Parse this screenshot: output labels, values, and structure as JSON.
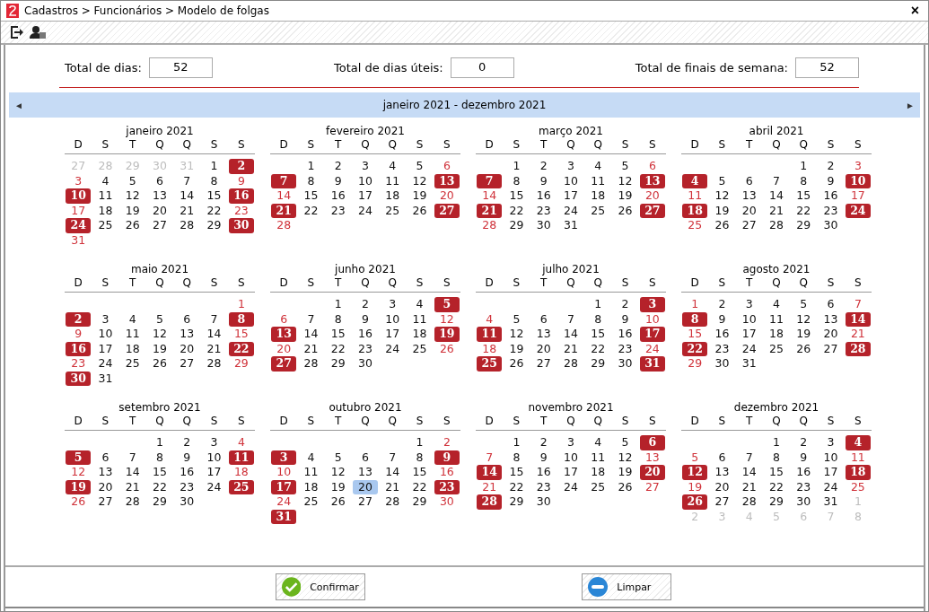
{
  "window": {
    "title": "Cadastros > Funcionários > Modelo de folgas",
    "close": "×"
  },
  "totals": [
    {
      "label": "Total de dias:",
      "value": "52"
    },
    {
      "label": "Total de dias úteis:",
      "value": "0"
    },
    {
      "label": "Total de finais de semana:",
      "value": "52"
    }
  ],
  "navigator": {
    "prev": "◄",
    "range": "janeiro 2021 - dezembro 2021",
    "next": "►"
  },
  "months": [
    {
      "title": "janeiro 2021",
      "weekdays": [
        "D",
        "S",
        "T",
        "Q",
        "Q",
        "S",
        "S"
      ],
      "weeks": [
        [
          {
            "day": "27",
            "kind": "outside"
          },
          {
            "day": "28",
            "kind": "outside"
          },
          {
            "day": "29",
            "kind": "outside"
          },
          {
            "day": "30",
            "kind": "outside"
          },
          {
            "day": "31",
            "kind": "outside"
          },
          {
            "day": "1",
            "kind": "weekday"
          },
          {
            "day": "2",
            "kind": "folga"
          }
        ],
        [
          {
            "day": "3",
            "kind": "weekend"
          },
          {
            "day": "4",
            "kind": "weekday"
          },
          {
            "day": "5",
            "kind": "weekday"
          },
          {
            "day": "6",
            "kind": "weekday"
          },
          {
            "day": "7",
            "kind": "weekday"
          },
          {
            "day": "8",
            "kind": "weekday"
          },
          {
            "day": "9",
            "kind": "weekend"
          }
        ],
        [
          {
            "day": "10",
            "kind": "folga"
          },
          {
            "day": "11",
            "kind": "weekday"
          },
          {
            "day": "12",
            "kind": "weekday"
          },
          {
            "day": "13",
            "kind": "weekday"
          },
          {
            "day": "14",
            "kind": "weekday"
          },
          {
            "day": "15",
            "kind": "weekday"
          },
          {
            "day": "16",
            "kind": "folga"
          }
        ],
        [
          {
            "day": "17",
            "kind": "weekend"
          },
          {
            "day": "18",
            "kind": "weekday"
          },
          {
            "day": "19",
            "kind": "weekday"
          },
          {
            "day": "20",
            "kind": "weekday"
          },
          {
            "day": "21",
            "kind": "weekday"
          },
          {
            "day": "22",
            "kind": "weekday"
          },
          {
            "day": "23",
            "kind": "weekend"
          }
        ],
        [
          {
            "day": "24",
            "kind": "folga"
          },
          {
            "day": "25",
            "kind": "weekday"
          },
          {
            "day": "26",
            "kind": "weekday"
          },
          {
            "day": "27",
            "kind": "weekday"
          },
          {
            "day": "28",
            "kind": "weekday"
          },
          {
            "day": "29",
            "kind": "weekday"
          },
          {
            "day": "30",
            "kind": "folga"
          }
        ],
        [
          {
            "day": "31",
            "kind": "weekend"
          }
        ]
      ]
    },
    {
      "title": "fevereiro 2021",
      "first_week_right_aligned": true,
      "weekdays": [
        "D",
        "S",
        "T",
        "Q",
        "Q",
        "S",
        "S"
      ],
      "weeks": [
        [
          {
            "day": "1",
            "kind": "weekday"
          },
          {
            "day": "2",
            "kind": "weekday"
          },
          {
            "day": "3",
            "kind": "weekday"
          },
          {
            "day": "4",
            "kind": "weekday"
          },
          {
            "day": "5",
            "kind": "weekday"
          },
          {
            "day": "6",
            "kind": "weekend"
          }
        ],
        [
          {
            "day": "7",
            "kind": "folga"
          },
          {
            "day": "8",
            "kind": "weekday"
          },
          {
            "day": "9",
            "kind": "weekday"
          },
          {
            "day": "10",
            "kind": "weekday"
          },
          {
            "day": "11",
            "kind": "weekday"
          },
          {
            "day": "12",
            "kind": "weekday"
          },
          {
            "day": "13",
            "kind": "folga"
          }
        ],
        [
          {
            "day": "14",
            "kind": "weekend"
          },
          {
            "day": "15",
            "kind": "weekday"
          },
          {
            "day": "16",
            "kind": "weekday"
          },
          {
            "day": "17",
            "kind": "weekday"
          },
          {
            "day": "18",
            "kind": "weekday"
          },
          {
            "day": "19",
            "kind": "weekday"
          },
          {
            "day": "20",
            "kind": "weekend"
          }
        ],
        [
          {
            "day": "21",
            "kind": "folga"
          },
          {
            "day": "22",
            "kind": "weekday"
          },
          {
            "day": "23",
            "kind": "weekday"
          },
          {
            "day": "24",
            "kind": "weekday"
          },
          {
            "day": "25",
            "kind": "weekday"
          },
          {
            "day": "26",
            "kind": "weekday"
          },
          {
            "day": "27",
            "kind": "folga"
          }
        ],
        [
          {
            "day": "28",
            "kind": "weekend"
          }
        ]
      ]
    },
    {
      "title": "março 2021",
      "first_week_right_aligned": true,
      "weekdays": [
        "D",
        "S",
        "T",
        "Q",
        "Q",
        "S",
        "S"
      ],
      "weeks": [
        [
          {
            "day": "1",
            "kind": "weekday"
          },
          {
            "day": "2",
            "kind": "weekday"
          },
          {
            "day": "3",
            "kind": "weekday"
          },
          {
            "day": "4",
            "kind": "weekday"
          },
          {
            "day": "5",
            "kind": "weekday"
          },
          {
            "day": "6",
            "kind": "weekend"
          }
        ],
        [
          {
            "day": "7",
            "kind": "folga"
          },
          {
            "day": "8",
            "kind": "weekday"
          },
          {
            "day": "9",
            "kind": "weekday"
          },
          {
            "day": "10",
            "kind": "weekday"
          },
          {
            "day": "11",
            "kind": "weekday"
          },
          {
            "day": "12",
            "kind": "weekday"
          },
          {
            "day": "13",
            "kind": "folga"
          }
        ],
        [
          {
            "day": "14",
            "kind": "weekend"
          },
          {
            "day": "15",
            "kind": "weekday"
          },
          {
            "day": "16",
            "kind": "weekday"
          },
          {
            "day": "17",
            "kind": "weekday"
          },
          {
            "day": "18",
            "kind": "weekday"
          },
          {
            "day": "19",
            "kind": "weekday"
          },
          {
            "day": "20",
            "kind": "weekend"
          }
        ],
        [
          {
            "day": "21",
            "kind": "folga"
          },
          {
            "day": "22",
            "kind": "weekday"
          },
          {
            "day": "23",
            "kind": "weekday"
          },
          {
            "day": "24",
            "kind": "weekday"
          },
          {
            "day": "25",
            "kind": "weekday"
          },
          {
            "day": "26",
            "kind": "weekday"
          },
          {
            "day": "27",
            "kind": "folga"
          }
        ],
        [
          {
            "day": "28",
            "kind": "weekend"
          },
          {
            "day": "29",
            "kind": "weekday"
          },
          {
            "day": "30",
            "kind": "weekday"
          },
          {
            "day": "31",
            "kind": "weekday"
          }
        ]
      ]
    },
    {
      "title": "abril 2021",
      "first_week_right_aligned": true,
      "weekdays": [
        "D",
        "S",
        "T",
        "Q",
        "Q",
        "S",
        "S"
      ],
      "weeks": [
        [
          {
            "day": "1",
            "kind": "weekday"
          },
          {
            "day": "2",
            "kind": "weekday"
          },
          {
            "day": "3",
            "kind": "weekend"
          }
        ],
        [
          {
            "day": "4",
            "kind": "folga"
          },
          {
            "day": "5",
            "kind": "weekday"
          },
          {
            "day": "6",
            "kind": "weekday"
          },
          {
            "day": "7",
            "kind": "weekday"
          },
          {
            "day": "8",
            "kind": "weekday"
          },
          {
            "day": "9",
            "kind": "weekday"
          },
          {
            "day": "10",
            "kind": "folga"
          }
        ],
        [
          {
            "day": "11",
            "kind": "weekend"
          },
          {
            "day": "12",
            "kind": "weekday"
          },
          {
            "day": "13",
            "kind": "weekday"
          },
          {
            "day": "14",
            "kind": "weekday"
          },
          {
            "day": "15",
            "kind": "weekday"
          },
          {
            "day": "16",
            "kind": "weekday"
          },
          {
            "day": "17",
            "kind": "weekend"
          }
        ],
        [
          {
            "day": "18",
            "kind": "folga"
          },
          {
            "day": "19",
            "kind": "weekday"
          },
          {
            "day": "20",
            "kind": "weekday"
          },
          {
            "day": "21",
            "kind": "weekday"
          },
          {
            "day": "22",
            "kind": "weekday"
          },
          {
            "day": "23",
            "kind": "weekday"
          },
          {
            "day": "24",
            "kind": "folga"
          }
        ],
        [
          {
            "day": "25",
            "kind": "weekend"
          },
          {
            "day": "26",
            "kind": "weekday"
          },
          {
            "day": "27",
            "kind": "weekday"
          },
          {
            "day": "28",
            "kind": "weekday"
          },
          {
            "day": "29",
            "kind": "weekday"
          },
          {
            "day": "30",
            "kind": "weekday"
          }
        ]
      ]
    },
    {
      "title": "maio 2021",
      "first_week_right_aligned": true,
      "weekdays": [
        "D",
        "S",
        "T",
        "Q",
        "Q",
        "S",
        "S"
      ],
      "weeks": [
        [
          {
            "day": "1",
            "kind": "weekend"
          }
        ],
        [
          {
            "day": "2",
            "kind": "folga"
          },
          {
            "day": "3",
            "kind": "weekday"
          },
          {
            "day": "4",
            "kind": "weekday"
          },
          {
            "day": "5",
            "kind": "weekday"
          },
          {
            "day": "6",
            "kind": "weekday"
          },
          {
            "day": "7",
            "kind": "weekday"
          },
          {
            "day": "8",
            "kind": "folga"
          }
        ],
        [
          {
            "day": "9",
            "kind": "weekend"
          },
          {
            "day": "10",
            "kind": "weekday"
          },
          {
            "day": "11",
            "kind": "weekday"
          },
          {
            "day": "12",
            "kind": "weekday"
          },
          {
            "day": "13",
            "kind": "weekday"
          },
          {
            "day": "14",
            "kind": "weekday"
          },
          {
            "day": "15",
            "kind": "weekend"
          }
        ],
        [
          {
            "day": "16",
            "kind": "folga"
          },
          {
            "day": "17",
            "kind": "weekday"
          },
          {
            "day": "18",
            "kind": "weekday"
          },
          {
            "day": "19",
            "kind": "weekday"
          },
          {
            "day": "20",
            "kind": "weekday"
          },
          {
            "day": "21",
            "kind": "weekday"
          },
          {
            "day": "22",
            "kind": "folga"
          }
        ],
        [
          {
            "day": "23",
            "kind": "weekend"
          },
          {
            "day": "24",
            "kind": "weekday"
          },
          {
            "day": "25",
            "kind": "weekday"
          },
          {
            "day": "26",
            "kind": "weekday"
          },
          {
            "day": "27",
            "kind": "weekday"
          },
          {
            "day": "28",
            "kind": "weekday"
          },
          {
            "day": "29",
            "kind": "weekend"
          }
        ],
        [
          {
            "day": "30",
            "kind": "folga"
          },
          {
            "day": "31",
            "kind": "weekday"
          }
        ]
      ]
    },
    {
      "title": "junho 2021",
      "first_week_right_aligned": true,
      "weekdays": [
        "D",
        "S",
        "T",
        "Q",
        "Q",
        "S",
        "S"
      ],
      "weeks": [
        [
          {
            "day": "1",
            "kind": "weekday"
          },
          {
            "day": "2",
            "kind": "weekday"
          },
          {
            "day": "3",
            "kind": "weekday"
          },
          {
            "day": "4",
            "kind": "weekday"
          },
          {
            "day": "5",
            "kind": "folga"
          }
        ],
        [
          {
            "day": "6",
            "kind": "weekend"
          },
          {
            "day": "7",
            "kind": "weekday"
          },
          {
            "day": "8",
            "kind": "weekday"
          },
          {
            "day": "9",
            "kind": "weekday"
          },
          {
            "day": "10",
            "kind": "weekday"
          },
          {
            "day": "11",
            "kind": "weekday"
          },
          {
            "day": "12",
            "kind": "weekend"
          }
        ],
        [
          {
            "day": "13",
            "kind": "folga"
          },
          {
            "day": "14",
            "kind": "weekday"
          },
          {
            "day": "15",
            "kind": "weekday"
          },
          {
            "day": "16",
            "kind": "weekday"
          },
          {
            "day": "17",
            "kind": "weekday"
          },
          {
            "day": "18",
            "kind": "weekday"
          },
          {
            "day": "19",
            "kind": "folga"
          }
        ],
        [
          {
            "day": "20",
            "kind": "weekend"
          },
          {
            "day": "21",
            "kind": "weekday"
          },
          {
            "day": "22",
            "kind": "weekday"
          },
          {
            "day": "23",
            "kind": "weekday"
          },
          {
            "day": "24",
            "kind": "weekday"
          },
          {
            "day": "25",
            "kind": "weekday"
          },
          {
            "day": "26",
            "kind": "weekend"
          }
        ],
        [
          {
            "day": "27",
            "kind": "folga"
          },
          {
            "day": "28",
            "kind": "weekday"
          },
          {
            "day": "29",
            "kind": "weekday"
          },
          {
            "day": "30",
            "kind": "weekday"
          }
        ]
      ]
    },
    {
      "title": "julho 2021",
      "first_week_right_aligned": true,
      "weekdays": [
        "D",
        "S",
        "T",
        "Q",
        "Q",
        "S",
        "S"
      ],
      "weeks": [
        [
          {
            "day": "1",
            "kind": "weekday"
          },
          {
            "day": "2",
            "kind": "weekday"
          },
          {
            "day": "3",
            "kind": "folga"
          }
        ],
        [
          {
            "day": "4",
            "kind": "weekend"
          },
          {
            "day": "5",
            "kind": "weekday"
          },
          {
            "day": "6",
            "kind": "weekday"
          },
          {
            "day": "7",
            "kind": "weekday"
          },
          {
            "day": "8",
            "kind": "weekday"
          },
          {
            "day": "9",
            "kind": "weekday"
          },
          {
            "day": "10",
            "kind": "weekend"
          }
        ],
        [
          {
            "day": "11",
            "kind": "folga"
          },
          {
            "day": "12",
            "kind": "weekday"
          },
          {
            "day": "13",
            "kind": "weekday"
          },
          {
            "day": "14",
            "kind": "weekday"
          },
          {
            "day": "15",
            "kind": "weekday"
          },
          {
            "day": "16",
            "kind": "weekday"
          },
          {
            "day": "17",
            "kind": "folga"
          }
        ],
        [
          {
            "day": "18",
            "kind": "weekend"
          },
          {
            "day": "19",
            "kind": "weekday"
          },
          {
            "day": "20",
            "kind": "weekday"
          },
          {
            "day": "21",
            "kind": "weekday"
          },
          {
            "day": "22",
            "kind": "weekday"
          },
          {
            "day": "23",
            "kind": "weekday"
          },
          {
            "day": "24",
            "kind": "weekend"
          }
        ],
        [
          {
            "day": "25",
            "kind": "folga"
          },
          {
            "day": "26",
            "kind": "weekday"
          },
          {
            "day": "27",
            "kind": "weekday"
          },
          {
            "day": "28",
            "kind": "weekday"
          },
          {
            "day": "29",
            "kind": "weekday"
          },
          {
            "day": "30",
            "kind": "weekday"
          },
          {
            "day": "31",
            "kind": "folga"
          }
        ]
      ]
    },
    {
      "title": "agosto 2021",
      "weekdays": [
        "D",
        "S",
        "T",
        "Q",
        "Q",
        "S",
        "S"
      ],
      "weeks": [
        [
          {
            "day": "1",
            "kind": "weekend"
          },
          {
            "day": "2",
            "kind": "weekday"
          },
          {
            "day": "3",
            "kind": "weekday"
          },
          {
            "day": "4",
            "kind": "weekday"
          },
          {
            "day": "5",
            "kind": "weekday"
          },
          {
            "day": "6",
            "kind": "weekday"
          },
          {
            "day": "7",
            "kind": "weekend"
          }
        ],
        [
          {
            "day": "8",
            "kind": "folga"
          },
          {
            "day": "9",
            "kind": "weekday"
          },
          {
            "day": "10",
            "kind": "weekday"
          },
          {
            "day": "11",
            "kind": "weekday"
          },
          {
            "day": "12",
            "kind": "weekday"
          },
          {
            "day": "13",
            "kind": "weekday"
          },
          {
            "day": "14",
            "kind": "folga"
          }
        ],
        [
          {
            "day": "15",
            "kind": "weekend"
          },
          {
            "day": "16",
            "kind": "weekday"
          },
          {
            "day": "17",
            "kind": "weekday"
          },
          {
            "day": "18",
            "kind": "weekday"
          },
          {
            "day": "19",
            "kind": "weekday"
          },
          {
            "day": "20",
            "kind": "weekday"
          },
          {
            "day": "21",
            "kind": "weekend"
          }
        ],
        [
          {
            "day": "22",
            "kind": "folga"
          },
          {
            "day": "23",
            "kind": "weekday"
          },
          {
            "day": "24",
            "kind": "weekday"
          },
          {
            "day": "25",
            "kind": "weekday"
          },
          {
            "day": "26",
            "kind": "weekday"
          },
          {
            "day": "27",
            "kind": "weekday"
          },
          {
            "day": "28",
            "kind": "folga"
          }
        ],
        [
          {
            "day": "29",
            "kind": "weekend"
          },
          {
            "day": "30",
            "kind": "weekday"
          },
          {
            "day": "31",
            "kind": "weekday"
          }
        ]
      ]
    },
    {
      "title": "setembro 2021",
      "first_week_right_aligned": true,
      "weekdays": [
        "D",
        "S",
        "T",
        "Q",
        "Q",
        "S",
        "S"
      ],
      "weeks": [
        [
          {
            "day": "1",
            "kind": "weekday"
          },
          {
            "day": "2",
            "kind": "weekday"
          },
          {
            "day": "3",
            "kind": "weekday"
          },
          {
            "day": "4",
            "kind": "weekend"
          }
        ],
        [
          {
            "day": "5",
            "kind": "folga"
          },
          {
            "day": "6",
            "kind": "weekday"
          },
          {
            "day": "7",
            "kind": "weekday"
          },
          {
            "day": "8",
            "kind": "weekday"
          },
          {
            "day": "9",
            "kind": "weekday"
          },
          {
            "day": "10",
            "kind": "weekday"
          },
          {
            "day": "11",
            "kind": "folga"
          }
        ],
        [
          {
            "day": "12",
            "kind": "weekend"
          },
          {
            "day": "13",
            "kind": "weekday"
          },
          {
            "day": "14",
            "kind": "weekday"
          },
          {
            "day": "15",
            "kind": "weekday"
          },
          {
            "day": "16",
            "kind": "weekday"
          },
          {
            "day": "17",
            "kind": "weekday"
          },
          {
            "day": "18",
            "kind": "weekend"
          }
        ],
        [
          {
            "day": "19",
            "kind": "folga"
          },
          {
            "day": "20",
            "kind": "weekday"
          },
          {
            "day": "21",
            "kind": "weekday"
          },
          {
            "day": "22",
            "kind": "weekday"
          },
          {
            "day": "23",
            "kind": "weekday"
          },
          {
            "day": "24",
            "kind": "weekday"
          },
          {
            "day": "25",
            "kind": "folga"
          }
        ],
        [
          {
            "day": "26",
            "kind": "weekend"
          },
          {
            "day": "27",
            "kind": "weekday"
          },
          {
            "day": "28",
            "kind": "weekday"
          },
          {
            "day": "29",
            "kind": "weekday"
          },
          {
            "day": "30",
            "kind": "weekday"
          }
        ]
      ]
    },
    {
      "title": "outubro 2021",
      "first_week_right_aligned": true,
      "weekdays": [
        "D",
        "S",
        "T",
        "Q",
        "Q",
        "S",
        "S"
      ],
      "weeks": [
        [
          {
            "day": "1",
            "kind": "weekday"
          },
          {
            "day": "2",
            "kind": "weekend"
          }
        ],
        [
          {
            "day": "3",
            "kind": "folga"
          },
          {
            "day": "4",
            "kind": "weekday"
          },
          {
            "day": "5",
            "kind": "weekday"
          },
          {
            "day": "6",
            "kind": "weekday"
          },
          {
            "day": "7",
            "kind": "weekday"
          },
          {
            "day": "8",
            "kind": "weekday"
          },
          {
            "day": "9",
            "kind": "folga"
          }
        ],
        [
          {
            "day": "10",
            "kind": "weekend"
          },
          {
            "day": "11",
            "kind": "weekday"
          },
          {
            "day": "12",
            "kind": "weekday"
          },
          {
            "day": "13",
            "kind": "weekday"
          },
          {
            "day": "14",
            "kind": "weekday"
          },
          {
            "day": "15",
            "kind": "weekday"
          },
          {
            "day": "16",
            "kind": "weekend"
          }
        ],
        [
          {
            "day": "17",
            "kind": "folga"
          },
          {
            "day": "18",
            "kind": "weekday"
          },
          {
            "day": "19",
            "kind": "weekday"
          },
          {
            "day": "20",
            "kind": "today"
          },
          {
            "day": "21",
            "kind": "weekday"
          },
          {
            "day": "22",
            "kind": "weekday"
          },
          {
            "day": "23",
            "kind": "folga"
          }
        ],
        [
          {
            "day": "24",
            "kind": "weekend"
          },
          {
            "day": "25",
            "kind": "weekday"
          },
          {
            "day": "26",
            "kind": "weekday"
          },
          {
            "day": "27",
            "kind": "weekday"
          },
          {
            "day": "28",
            "kind": "weekday"
          },
          {
            "day": "29",
            "kind": "weekday"
          },
          {
            "day": "30",
            "kind": "weekend"
          }
        ],
        [
          {
            "day": "31",
            "kind": "folga"
          }
        ]
      ]
    },
    {
      "title": "novembro 2021",
      "first_week_right_aligned": true,
      "weekdays": [
        "D",
        "S",
        "T",
        "Q",
        "Q",
        "S",
        "S"
      ],
      "weeks": [
        [
          {
            "day": "1",
            "kind": "weekday"
          },
          {
            "day": "2",
            "kind": "weekday"
          },
          {
            "day": "3",
            "kind": "weekday"
          },
          {
            "day": "4",
            "kind": "weekday"
          },
          {
            "day": "5",
            "kind": "weekday"
          },
          {
            "day": "6",
            "kind": "folga"
          }
        ],
        [
          {
            "day": "7",
            "kind": "weekend"
          },
          {
            "day": "8",
            "kind": "weekday"
          },
          {
            "day": "9",
            "kind": "weekday"
          },
          {
            "day": "10",
            "kind": "weekday"
          },
          {
            "day": "11",
            "kind": "weekday"
          },
          {
            "day": "12",
            "kind": "weekday"
          },
          {
            "day": "13",
            "kind": "weekend"
          }
        ],
        [
          {
            "day": "14",
            "kind": "folga"
          },
          {
            "day": "15",
            "kind": "weekday"
          },
          {
            "day": "16",
            "kind": "weekday"
          },
          {
            "day": "17",
            "kind": "weekday"
          },
          {
            "day": "18",
            "kind": "weekday"
          },
          {
            "day": "19",
            "kind": "weekday"
          },
          {
            "day": "20",
            "kind": "folga"
          }
        ],
        [
          {
            "day": "21",
            "kind": "weekend"
          },
          {
            "day": "22",
            "kind": "weekday"
          },
          {
            "day": "23",
            "kind": "weekday"
          },
          {
            "day": "24",
            "kind": "weekday"
          },
          {
            "day": "25",
            "kind": "weekday"
          },
          {
            "day": "26",
            "kind": "weekday"
          },
          {
            "day": "27",
            "kind": "weekend"
          }
        ],
        [
          {
            "day": "28",
            "kind": "folga"
          },
          {
            "day": "29",
            "kind": "weekday"
          },
          {
            "day": "30",
            "kind": "weekday"
          }
        ]
      ]
    },
    {
      "title": "dezembro 2021",
      "first_week_right_aligned": true,
      "weekdays": [
        "D",
        "S",
        "T",
        "Q",
        "Q",
        "S",
        "S"
      ],
      "weeks": [
        [
          {
            "day": "1",
            "kind": "weekday"
          },
          {
            "day": "2",
            "kind": "weekday"
          },
          {
            "day": "3",
            "kind": "weekday"
          },
          {
            "day": "4",
            "kind": "folga"
          }
        ],
        [
          {
            "day": "5",
            "kind": "weekend"
          },
          {
            "day": "6",
            "kind": "weekday"
          },
          {
            "day": "7",
            "kind": "weekday"
          },
          {
            "day": "8",
            "kind": "weekday"
          },
          {
            "day": "9",
            "kind": "weekday"
          },
          {
            "day": "10",
            "kind": "weekday"
          },
          {
            "day": "11",
            "kind": "weekend"
          }
        ],
        [
          {
            "day": "12",
            "kind": "folga"
          },
          {
            "day": "13",
            "kind": "weekday"
          },
          {
            "day": "14",
            "kind": "weekday"
          },
          {
            "day": "15",
            "kind": "weekday"
          },
          {
            "day": "16",
            "kind": "weekday"
          },
          {
            "day": "17",
            "kind": "weekday"
          },
          {
            "day": "18",
            "kind": "folga"
          }
        ],
        [
          {
            "day": "19",
            "kind": "weekend"
          },
          {
            "day": "20",
            "kind": "weekday"
          },
          {
            "day": "21",
            "kind": "weekday"
          },
          {
            "day": "22",
            "kind": "weekday"
          },
          {
            "day": "23",
            "kind": "weekday"
          },
          {
            "day": "24",
            "kind": "weekday"
          },
          {
            "day": "25",
            "kind": "weekend"
          }
        ],
        [
          {
            "day": "26",
            "kind": "folga"
          },
          {
            "day": "27",
            "kind": "weekday"
          },
          {
            "day": "28",
            "kind": "weekday"
          },
          {
            "day": "29",
            "kind": "weekday"
          },
          {
            "day": "30",
            "kind": "weekday"
          },
          {
            "day": "31",
            "kind": "weekday"
          },
          {
            "day": "1",
            "kind": "outside"
          }
        ],
        [
          {
            "day": "2",
            "kind": "outside"
          },
          {
            "day": "3",
            "kind": "outside"
          },
          {
            "day": "4",
            "kind": "outside"
          },
          {
            "day": "5",
            "kind": "outside"
          },
          {
            "day": "6",
            "kind": "outside"
          },
          {
            "day": "7",
            "kind": "outside"
          },
          {
            "day": "8",
            "kind": "outside"
          }
        ]
      ]
    }
  ],
  "buttons": [
    {
      "label": "Confirmar",
      "kind": "confirm"
    },
    {
      "label": "Limpar",
      "kind": "clear"
    }
  ]
}
